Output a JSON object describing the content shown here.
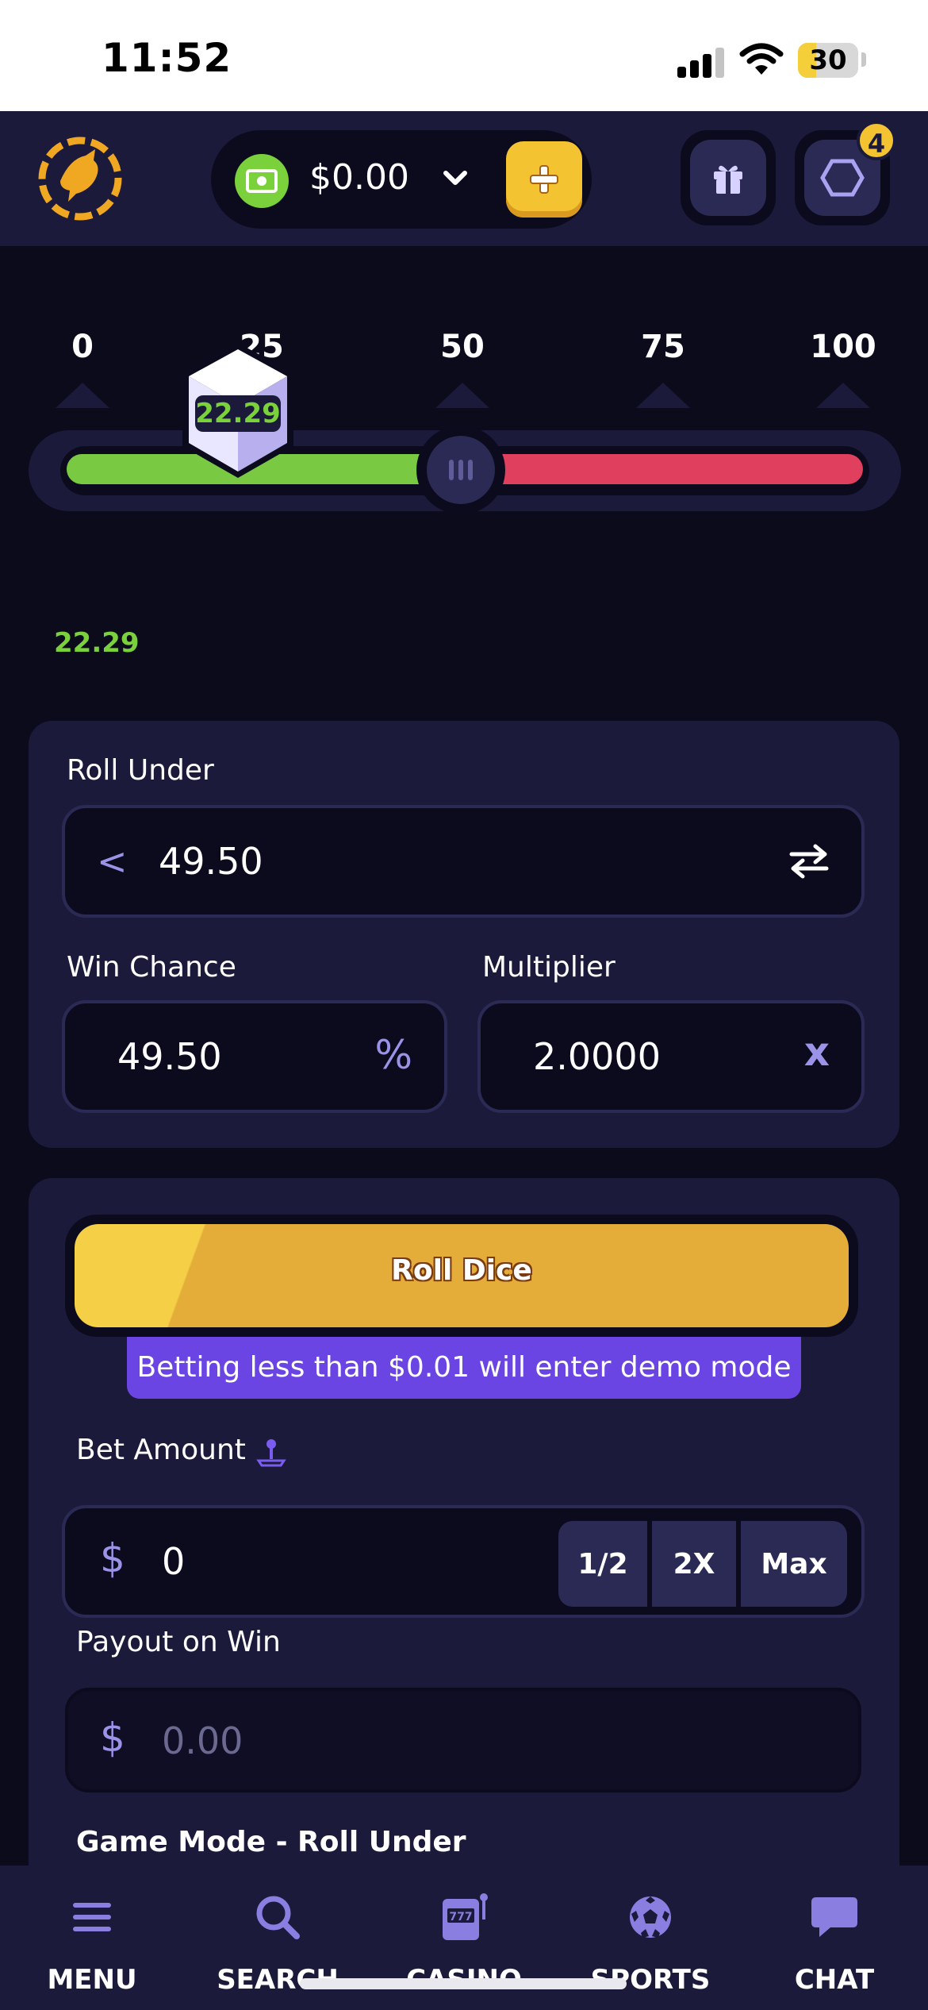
{
  "status_bar": {
    "time": "11:52",
    "battery": "30",
    "icons": [
      "signal-icon",
      "wifi-icon",
      "battery-icon"
    ]
  },
  "header": {
    "logo": "kangaroo-logo",
    "balance": "$0.00",
    "notifications_count": "4",
    "icons": [
      "cash-icon",
      "chevron-down-icon",
      "plus-icon",
      "gift-icon",
      "hexagon-icon"
    ]
  },
  "dice": {
    "scale": [
      "0",
      "25",
      "50",
      "75",
      "100"
    ],
    "roll_target": 49.5,
    "result": "22.29",
    "last_result": "22.29",
    "colors": {
      "win": "#7ac943",
      "lose": "#e0405e"
    }
  },
  "settings": {
    "roll_under_label": "Roll Under",
    "roll_under_prefix": "<",
    "roll_under_value": "49.50",
    "win_chance_label": "Win Chance",
    "win_chance_value": "49.50",
    "win_chance_suffix": "%",
    "multiplier_label": "Multiplier",
    "multiplier_value": "2.0000",
    "multiplier_suffix": "x"
  },
  "bet": {
    "roll_button": "Roll Dice",
    "demo_notice": "Betting less than $0.01 will enter demo mode",
    "bet_amount_label": "Bet Amount",
    "currency": "$",
    "bet_amount_value": "0",
    "half_label": "1/2",
    "double_label": "2X",
    "max_label": "Max",
    "payout_label": "Payout on Win",
    "payout_placeholder": "0.00",
    "game_mode_label": "Game Mode - Roll Under"
  },
  "nav": {
    "items": [
      {
        "label": "MENU",
        "icon": "menu-icon"
      },
      {
        "label": "SEARCH",
        "icon": "search-icon"
      },
      {
        "label": "CASINO",
        "icon": "slot-machine-icon"
      },
      {
        "label": "SPORTS",
        "icon": "soccer-ball-icon"
      },
      {
        "label": "CHAT",
        "icon": "chat-bubble-icon"
      }
    ]
  }
}
